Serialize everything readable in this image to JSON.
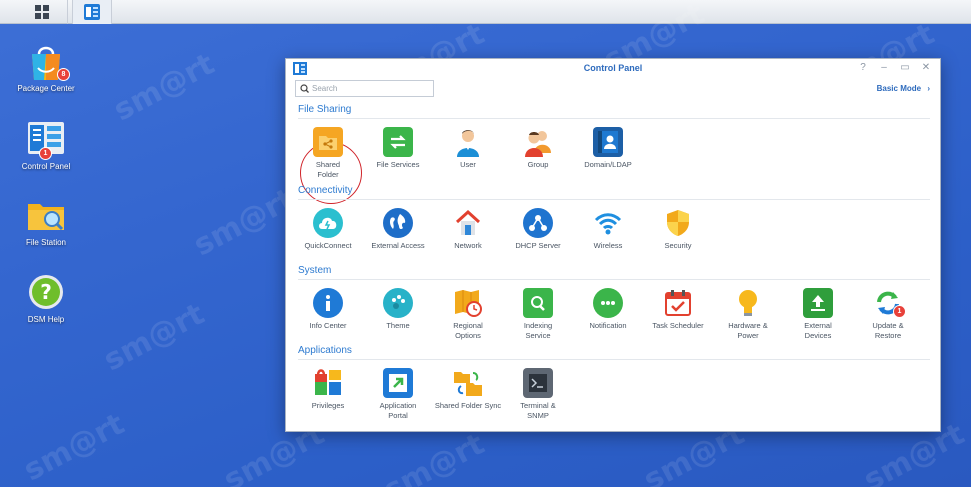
{
  "taskbar": {
    "main_menu_icon": "grid-icon",
    "open_app_icon": "control-panel-icon"
  },
  "watermark_text": "sm@rt",
  "desktop": {
    "icons": [
      {
        "label": "Package Center",
        "icon": "shopping-bag-icon",
        "badge": "8"
      },
      {
        "label": "Control Panel",
        "icon": "control-panel-icon",
        "badge": "1"
      },
      {
        "label": "File Station",
        "icon": "folder-search-icon"
      },
      {
        "label": "DSM Help",
        "icon": "help-icon"
      }
    ]
  },
  "window": {
    "title": "Control Panel",
    "controls": [
      "?",
      "–",
      "▭",
      "✕"
    ],
    "search_placeholder": "Search",
    "basic_mode_label": "Basic Mode",
    "sections": [
      {
        "title": "File Sharing",
        "items": [
          "Shared Folder",
          "File Services",
          "User",
          "Group",
          "Domain/LDAP"
        ]
      },
      {
        "title": "Connectivity",
        "items": [
          "QuickConnect",
          "External Access",
          "Network",
          "DHCP Server",
          "Wireless",
          "Security"
        ]
      },
      {
        "title": "System",
        "items": [
          "Info Center",
          "Theme",
          "Regional Options",
          "Indexing Service",
          "Notification",
          "Task Scheduler",
          "Hardware & Power",
          "External Devices",
          "Update & Restore"
        ]
      },
      {
        "title": "Applications",
        "items": [
          "Privileges",
          "Application Portal",
          "Shared Folder Sync",
          "Terminal & SNMP"
        ]
      }
    ],
    "update_badge": "1"
  },
  "colors": {
    "accent": "#2e7bd0",
    "desktop": "#3466cf",
    "highlight": "#d0242a"
  }
}
